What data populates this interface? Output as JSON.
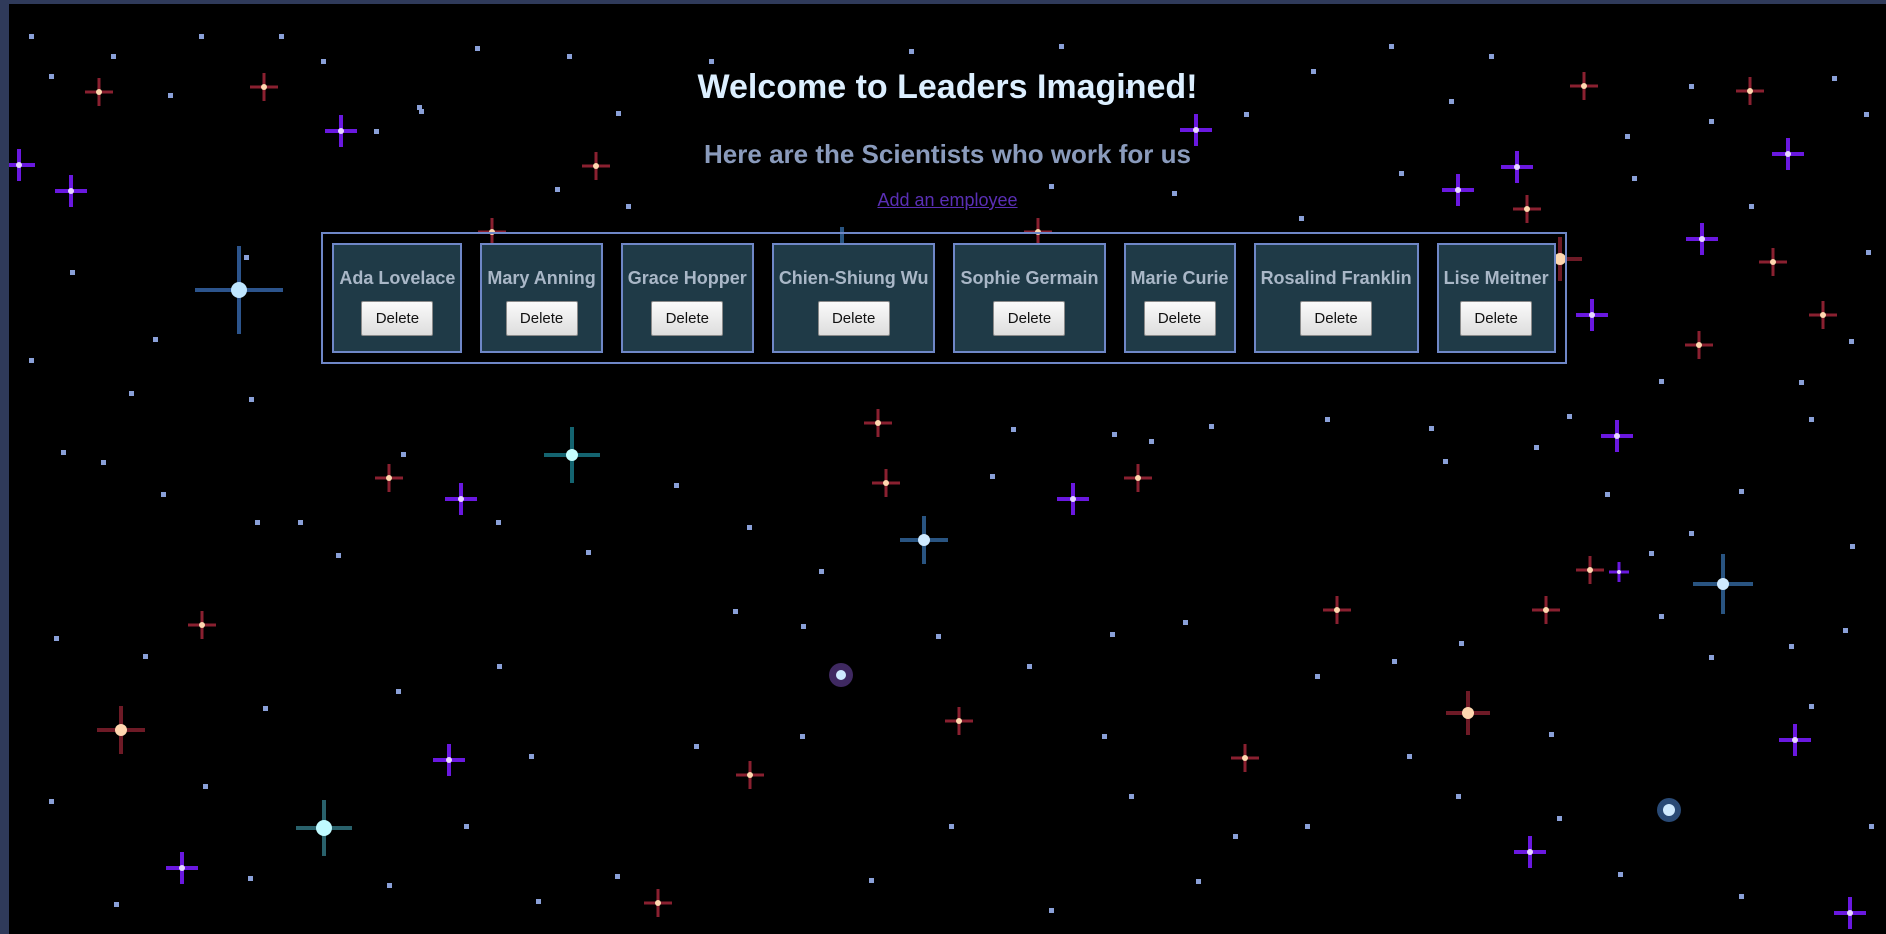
{
  "header": {
    "title": "Welcome to Leaders Imagined!",
    "subtitle": "Here are the Scientists who work for us",
    "add_link": "Add an employee"
  },
  "employees": [
    {
      "name": "Ada Lovelace",
      "delete_label": "Delete"
    },
    {
      "name": "Mary Anning",
      "delete_label": "Delete"
    },
    {
      "name": "Grace Hopper",
      "delete_label": "Delete"
    },
    {
      "name": "Chien-Shiung Wu",
      "delete_label": "Delete"
    },
    {
      "name": "Sophie Germain",
      "delete_label": "Delete"
    },
    {
      "name": "Marie Curie",
      "delete_label": "Delete"
    },
    {
      "name": "Rosalind Franklin",
      "delete_label": "Delete"
    },
    {
      "name": "Lise Meitner",
      "delete_label": "Delete"
    }
  ],
  "colors": {
    "background": "#000000",
    "title": "#dcefff",
    "subtitle": "#8a9bbc",
    "link": "#5a2fb5",
    "card_bg": "#1f3a47",
    "card_border": "#6f87c7"
  }
}
